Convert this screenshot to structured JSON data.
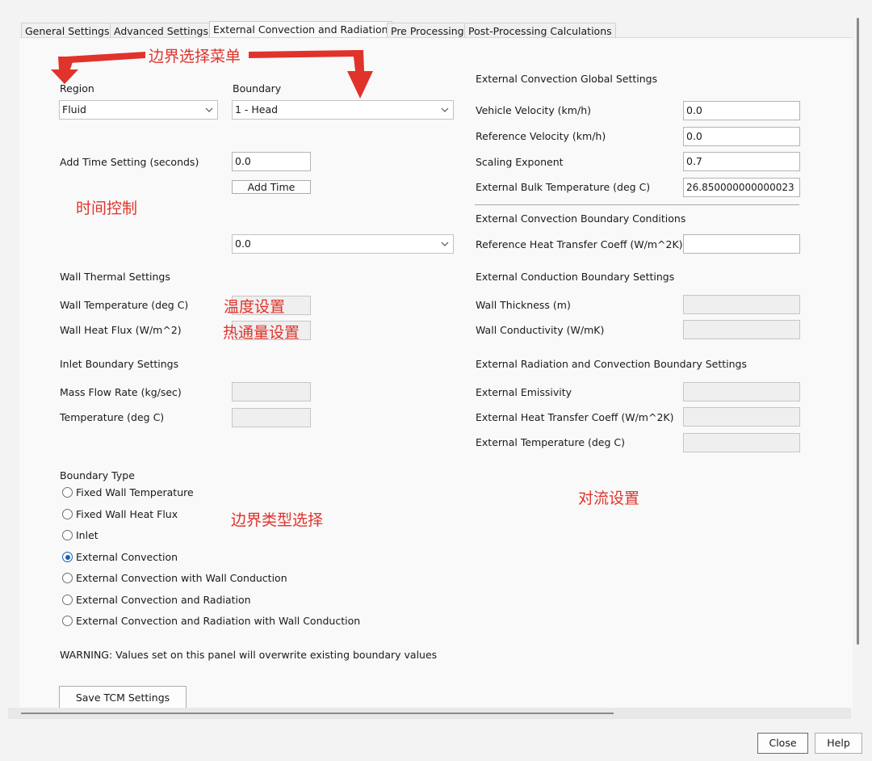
{
  "tabs": [
    {
      "label": "General Settings",
      "active": false
    },
    {
      "label": "Advanced Settings",
      "active": false
    },
    {
      "label": "External Convection and Radiation",
      "active": true
    },
    {
      "label": "Pre Processing",
      "active": false
    },
    {
      "label": "Post-Processing Calculations",
      "active": false
    }
  ],
  "region": {
    "label": "Region",
    "value": "Fluid"
  },
  "boundary": {
    "label": "Boundary",
    "value": "1 - Head"
  },
  "time": {
    "label": "Add Time Setting (seconds)",
    "value": "0.0",
    "add_button": "Add Time",
    "selected_time": "0.0"
  },
  "wall": {
    "heading": "Wall Thermal Settings",
    "temperature_label": "Wall Temperature (deg C)",
    "heat_flux_label": "Wall Heat Flux (W/m^2)"
  },
  "inlet": {
    "heading": "Inlet Boundary Settings",
    "mass_flow_label": "Mass Flow Rate (kg/sec)",
    "temperature_label": "Temperature (deg C)"
  },
  "boundary_type": {
    "heading": "Boundary Type",
    "options": [
      {
        "label": "Fixed Wall Temperature",
        "selected": false
      },
      {
        "label": "Fixed Wall Heat Flux",
        "selected": false
      },
      {
        "label": "Inlet",
        "selected": false
      },
      {
        "label": "External Convection",
        "selected": true
      },
      {
        "label": "External Convection with Wall Conduction",
        "selected": false
      },
      {
        "label": "External Convection and Radiation",
        "selected": false
      },
      {
        "label": "External Convection and Radiation with Wall Conduction",
        "selected": false
      }
    ]
  },
  "warning": "WARNING: Values set on this panel will overwrite existing boundary values",
  "save_button": "Save TCM Settings",
  "global": {
    "heading": "External Convection Global Settings",
    "vehicle_velocity_label": "Vehicle Velocity (km/h)",
    "vehicle_velocity": "0.0",
    "reference_velocity_label": "Reference Velocity (km/h)",
    "reference_velocity": "0.0",
    "scaling_exponent_label": "Scaling Exponent",
    "scaling_exponent": "0.7",
    "bulk_temp_label": "External Bulk Temperature (deg C)",
    "bulk_temp": "26.850000000000023"
  },
  "bc": {
    "heading": "External Convection Boundary Conditions",
    "ref_htc_label": "Reference Heat Transfer Coeff (W/m^2K)",
    "ref_htc": ""
  },
  "conduction": {
    "heading": "External Conduction Boundary Settings",
    "thickness_label": "Wall Thickness (m)",
    "conductivity_label": "Wall Conductivity (W/mK)"
  },
  "radiation": {
    "heading": "External Radiation and Convection Boundary Settings",
    "emissivity_label": "External Emissivity",
    "htc_label": "External Heat Transfer Coeff (W/m^2K)",
    "temp_label": "External Temperature (deg C)"
  },
  "annotations": {
    "boundary_menu": "边界选择菜单",
    "time_control": "时间控制",
    "temperature_setting": "温度设置",
    "heat_flux_setting": "热通量设置",
    "boundary_type_select": "边界类型选择",
    "convection_setting": "对流设置"
  },
  "footer": {
    "close": "Close",
    "help": "Help"
  },
  "colors": {
    "annotation": "#e0332b",
    "radio_accent": "#1a5fb4"
  },
  "icons": {
    "dropdown": "chevron-down-icon",
    "arrow": "arrow-down-icon"
  }
}
